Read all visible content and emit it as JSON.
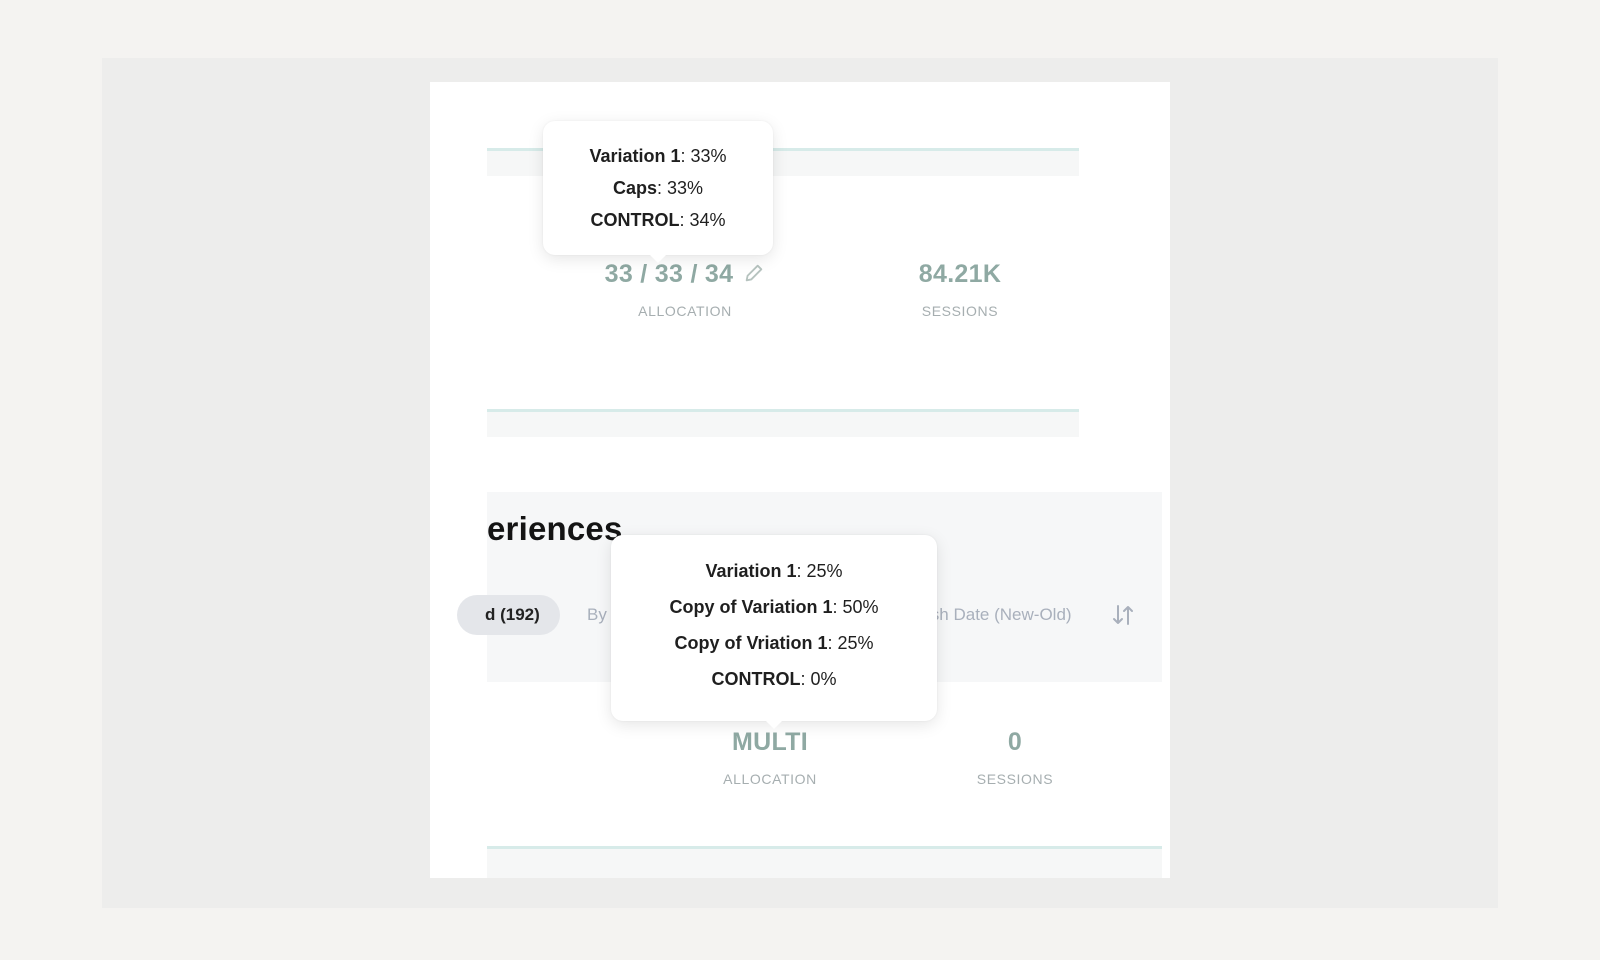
{
  "experience_1": {
    "allocation_value": "33 / 33 / 34",
    "allocation_label": "ALLOCATION",
    "sessions_value": "84.21K",
    "sessions_label": "SESSIONS",
    "tooltip": [
      {
        "name": "Variation 1",
        "value": ": 33%"
      },
      {
        "name": "Caps",
        "value": ": 33%"
      },
      {
        "name": "CONTROL",
        "value": ": 34%"
      }
    ]
  },
  "experiences_section": {
    "title": "eriences",
    "filter_pill": "d (192)",
    "filter_by": "By",
    "sort_label": "Publish Date (New-Old)"
  },
  "experience_2": {
    "allocation_value": "MULTI",
    "allocation_label": "ALLOCATION",
    "sessions_value": "0",
    "sessions_label": "SESSIONS",
    "tooltip": [
      {
        "name": "Variation 1",
        "value": ": 25%"
      },
      {
        "name": "Copy of Variation 1",
        "value": ": 50%"
      },
      {
        "name": "Copy of Vriation 1",
        "value": ": 25%"
      },
      {
        "name": "CONTROL",
        "value": ": 0%"
      }
    ]
  },
  "colors": {
    "stat_value": "#8fa9a3",
    "band_accent": "#d7ebe9",
    "panel_bg": "#f6f7f8"
  }
}
